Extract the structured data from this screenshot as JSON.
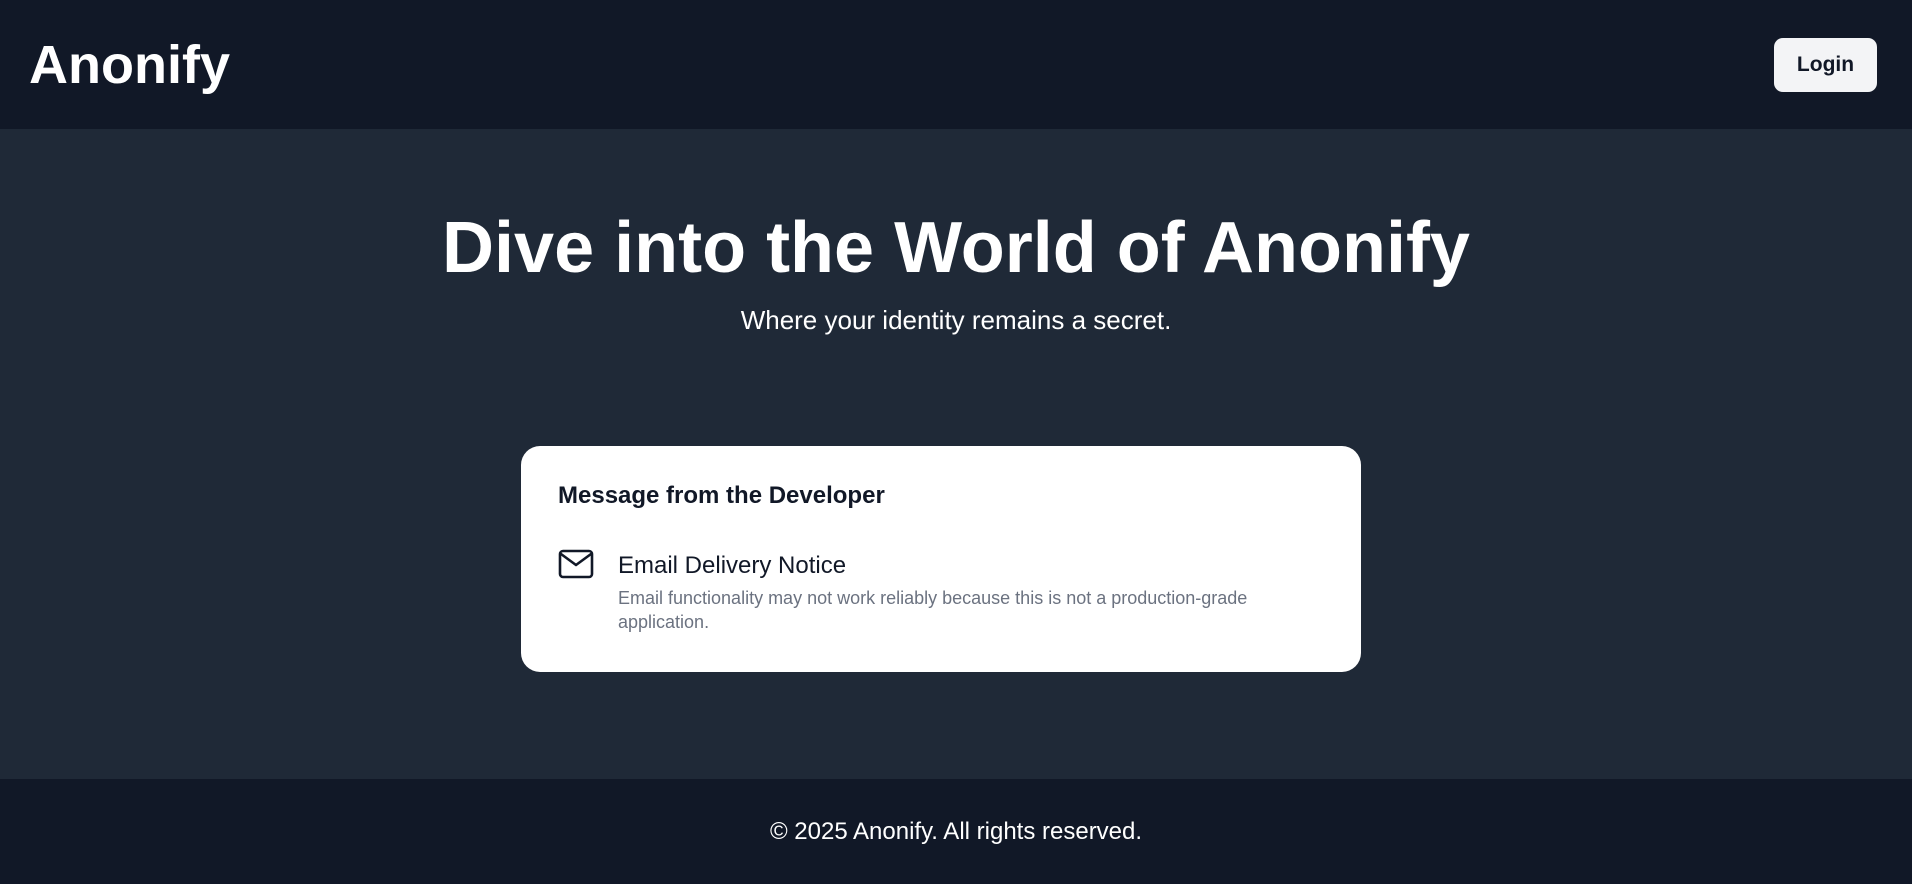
{
  "header": {
    "logo": "Anonify",
    "login_label": "Login"
  },
  "hero": {
    "title": "Dive into the World of Anonify",
    "subtitle": "Where your identity remains a secret."
  },
  "card": {
    "title": "Message from the Developer",
    "notice": {
      "icon": "mail-icon",
      "heading": "Email Delivery Notice",
      "body": "Email functionality may not work reliably because this is not a production-grade application."
    }
  },
  "footer": {
    "copyright": "© 2025 Anonify. All rights reserved."
  },
  "colors": {
    "header_bg": "#111827",
    "main_bg": "#1f2937",
    "card_bg": "#ffffff",
    "muted_text": "#6b7280"
  }
}
